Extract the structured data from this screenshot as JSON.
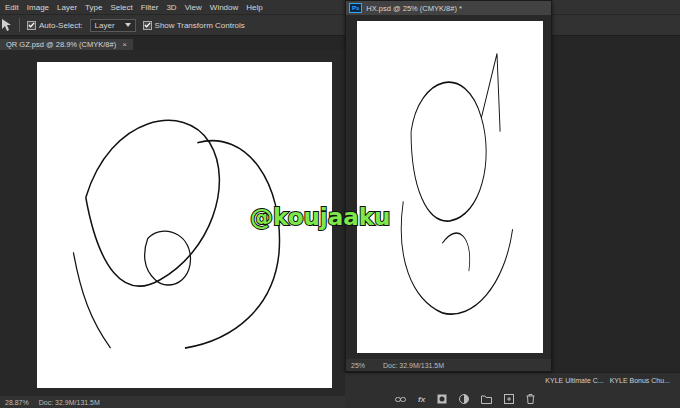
{
  "menu_bar": [
    "Edit",
    "Image",
    "Layer",
    "Type",
    "Select",
    "Filter",
    "3D",
    "View",
    "Window",
    "Help"
  ],
  "options_bar": {
    "auto_select": {
      "label": "Auto-Select:",
      "checked": true
    },
    "target": "Layer",
    "transform_controls": {
      "label": "Show Transform Controls",
      "checked": true
    }
  },
  "documents": [
    {
      "title": "QR GZ.psd @ 28.9% (CMYK/8#)",
      "close": "×",
      "zoom": "28.87%",
      "doc_size": "Doc: 32.9M/131.5M",
      "floating": false
    },
    {
      "title": "HX.psd @ 25% (CMYK/8#) *",
      "badge": "Ps",
      "zoom": "25%",
      "doc_size": "Doc: 32.9M/131.5M",
      "floating": true
    }
  ],
  "brush_panel": {
    "items": [
      "KYLE Ultimate C...",
      "KYLE Bonus Chu..."
    ]
  },
  "layers_footer": {
    "fx": "fx"
  },
  "watermark": "@koujaaku"
}
